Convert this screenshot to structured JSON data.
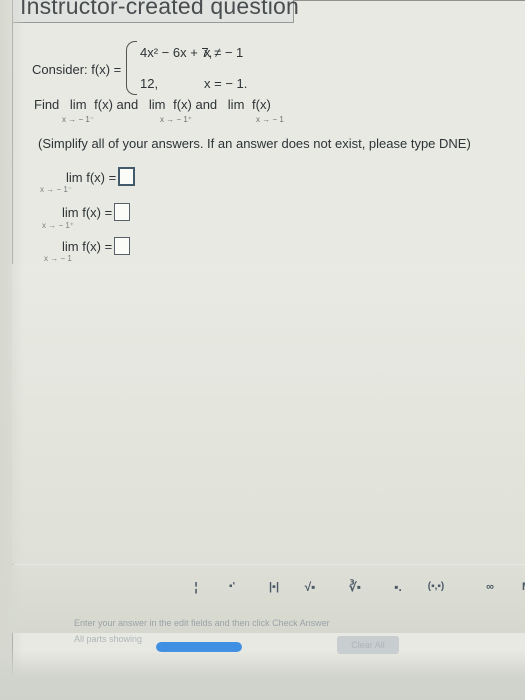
{
  "header": {
    "title": "Instructor-created question"
  },
  "question": {
    "consider": "Consider: f(x) =",
    "case_1_expression": "4x² − 6x + 7,",
    "case_1_condition": "x ≠ − 1",
    "case_2_value": "12,",
    "case_2_condition": "x = − 1.",
    "find_text": "Find",
    "lim_word": "lim",
    "fx_and_1": "f(x) and",
    "fx_and_2": "f(x) and",
    "fx_3": "f(x)",
    "sub_left": "x → − 1⁻",
    "sub_right": "x → − 1⁺",
    "sub_both": "x → − 1",
    "instructions": "(Simplify all of your answers. If an answer does not exist, please type DNE)"
  },
  "answers": {
    "rows": [
      {
        "label": "lim  f(x) =",
        "sub": "x → − 1⁻"
      },
      {
        "label": "lim  f(x) =",
        "sub": "x → − 1⁺"
      },
      {
        "label": "lim  f(x) =",
        "sub": "x → − 1"
      }
    ]
  },
  "toolbar": {
    "buttons": [
      "¦",
      "▪'",
      "|▪|",
      "√▪",
      "∛▪",
      "▪.",
      "(▪,▪)",
      "∞",
      "Mo"
    ]
  },
  "footer": {
    "helper_text": "Enter your answer in the edit fields and then click Check Answer",
    "parts_showing": "All parts showing",
    "clear_all": "Clear All"
  },
  "progress": {
    "fill": 1
  },
  "colors": {
    "text": "#2d3336",
    "border": "#58616a",
    "toolbar": "#d6d8cf",
    "progress": "#3f8fe2"
  }
}
